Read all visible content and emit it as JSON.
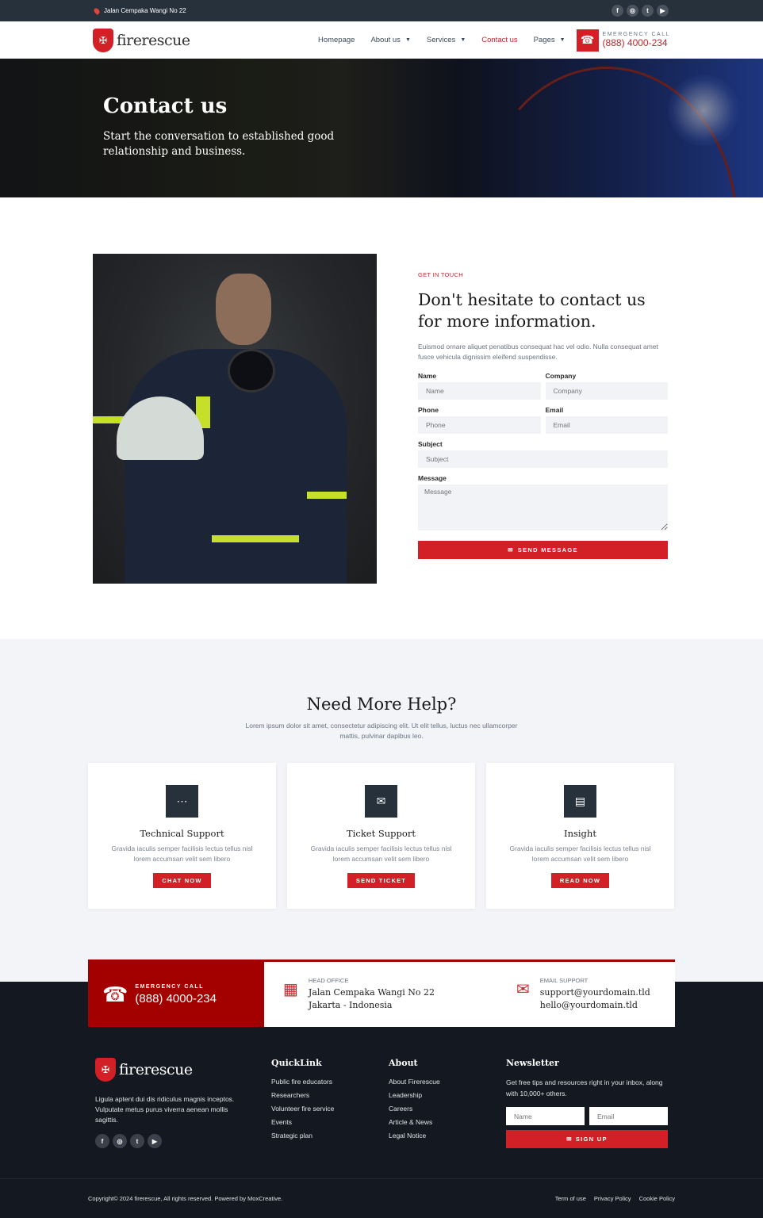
{
  "topbar": {
    "address": "Jalan Cempaka Wangi No 22",
    "socials": [
      {
        "icon": "facebook-icon",
        "glyph": "f"
      },
      {
        "icon": "instagram-icon",
        "glyph": "◎"
      },
      {
        "icon": "twitter-icon",
        "glyph": "t"
      },
      {
        "icon": "youtube-icon",
        "glyph": "▶"
      }
    ]
  },
  "nav": {
    "logo": "firerescue",
    "items": [
      {
        "label": "Homepage",
        "dropdown": false,
        "active": false
      },
      {
        "label": "About us",
        "dropdown": true,
        "active": false
      },
      {
        "label": "Services",
        "dropdown": true,
        "active": false
      },
      {
        "label": "Contact us",
        "dropdown": false,
        "active": true
      },
      {
        "label": "Pages",
        "dropdown": true,
        "active": false
      }
    ],
    "emergency_label": "EMERGENCY CALL",
    "emergency_number": "(888) 4000-234"
  },
  "hero": {
    "title": "Contact us",
    "subtitle": "Start the conversation to established good relationship and business."
  },
  "contact": {
    "eyebrow": "GET IN TOUCH",
    "heading": "Don't hesitate to contact us for more information.",
    "intro": "Euismod ornare aliquet penatibus consequat hac vel odio. Nulla consequat amet fusce vehicula dignissim eleifend suspendisse.",
    "fields": {
      "name": {
        "label": "Name",
        "placeholder": "Name",
        "value": ""
      },
      "company": {
        "label": "Company",
        "placeholder": "Company",
        "value": ""
      },
      "phone": {
        "label": "Phone",
        "placeholder": "Phone",
        "value": ""
      },
      "email": {
        "label": "Email",
        "placeholder": "Email",
        "value": ""
      },
      "subject": {
        "label": "Subject",
        "placeholder": "Subject",
        "value": ""
      },
      "message": {
        "label": "Message",
        "placeholder": "Message",
        "value": ""
      }
    },
    "submit_label": "SEND MESSAGE"
  },
  "help": {
    "title": "Need More Help?",
    "subtitle": "Lorem ipsum dolor sit amet, consectetur adipiscing elit. Ut elit tellus, luctus nec ullamcorper mattis, pulvinar dapibus leo.",
    "cards": [
      {
        "icon": "chat-icon",
        "glyph": "⋯",
        "title": "Technical Support",
        "text": "Gravida iaculis semper facilisis lectus tellus nisl lorem accumsan velit sem libero",
        "button": "CHAT NOW"
      },
      {
        "icon": "envelope-icon",
        "glyph": "✉",
        "title": "Ticket Support",
        "text": "Gravida iaculis semper facilisis lectus tellus nisl lorem accumsan velit sem libero",
        "button": "SEND TICKET"
      },
      {
        "icon": "document-icon",
        "glyph": "▤",
        "title": "Insight",
        "text": "Gravida iaculis semper facilisis lectus tellus nisl lorem accumsan velit sem libero",
        "button": "READ NOW"
      }
    ]
  },
  "info_strip": {
    "emergency_label": "EMERGENCY CALL",
    "emergency_number": "(888) 4000-234",
    "office_label": "HEAD OFFICE",
    "office_line1": "Jalan Cempaka Wangi No 22",
    "office_line2": "Jakarta - Indonesia",
    "email_label": "EMAIL SUPPORT",
    "email_line1": "support@yourdomain.tld",
    "email_line2": "hello@yourdomain.tld"
  },
  "footer": {
    "logo": "firerescue",
    "about_text": "Ligula aptent dui dis ridiculus magnis inceptos. Vulputate metus purus viverra aenean mollis sagittis.",
    "quicklink_title": "QuickLink",
    "quicklinks": [
      "Public fire educators",
      "Researchers",
      "Volunteer fire service",
      "Events",
      "Strategic plan"
    ],
    "about_title": "About",
    "about_links": [
      "About Firerescue",
      "Leadership",
      "Careers",
      "Article & News",
      "Legal Notice"
    ],
    "newsletter_title": "Newsletter",
    "newsletter_text": "Get free tips and resources right in your inbox, along with 10,000+ others.",
    "newsletter_name_placeholder": "Name",
    "newsletter_email_placeholder": "Email",
    "signup_label": "SIGN UP",
    "copyright": "Copyright© 2024 firerescue, All rights reserved. Powered by MoxCreative.",
    "legal_links": [
      "Term of use",
      "Privacy Policy",
      "Cookie Policy"
    ]
  },
  "colors": {
    "accent_red": "#d32027",
    "dark_red": "#a30000",
    "navy": "#27313c",
    "footer_bg": "#141820"
  }
}
